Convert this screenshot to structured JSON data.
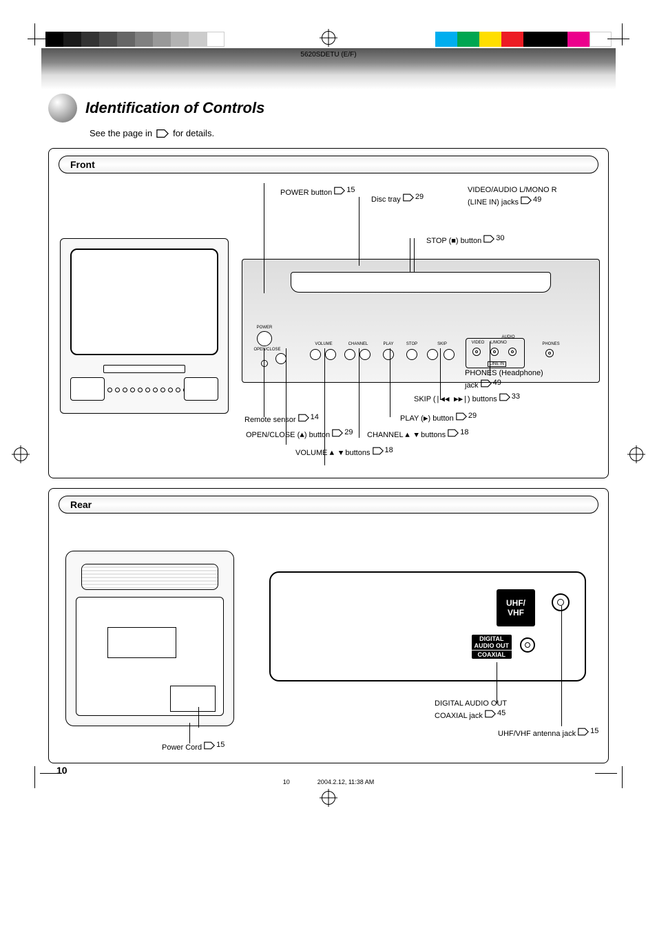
{
  "file_label": "5620SDETU (E/F)",
  "page_number": "10",
  "title": "Identification of Controls",
  "subtitle_prefix": "See the page in ",
  "subtitle_suffix": " for details.",
  "front": {
    "heading": "Front",
    "device_labels": {
      "power": "POWER",
      "open_close": "OPEN/CLOSE",
      "volume": "VOLUME",
      "channel": "CHANNEL",
      "play": "PLAY",
      "stop": "STOP",
      "skip": "SKIP",
      "video": "VIDEO",
      "l_mono": "L/MONO",
      "audio": "AUDIO",
      "line_in": "LINE IN",
      "phones": "PHONES"
    },
    "callouts": {
      "power": {
        "text": "POWER button",
        "page": "15"
      },
      "disc_tray": {
        "text": "Disc tray",
        "page": "29"
      },
      "stop": {
        "text": "STOP (  ) button",
        "page": "30"
      },
      "skip": {
        "text": "SKIP (      ) buttons",
        "page": "33"
      },
      "play": {
        "text": "PLAY (  ) button",
        "page": "29"
      },
      "channel": {
        "text": "CHANNEL       buttons",
        "page": "18"
      },
      "open_close": {
        "text": "OPEN/CLOSE (  ) button",
        "page": "29"
      },
      "remote_sensor": {
        "text": "Remote sensor",
        "page": "14"
      },
      "volume": {
        "text": "VOLUME       buttons",
        "page": "18"
      },
      "phones": {
        "text": "PHONES (Headphone) jack",
        "page": "49"
      },
      "line_in": {
        "line1": "VIDEO/AUDIO L/MONO R",
        "line2": "(LINE IN) jacks",
        "page": "49"
      }
    }
  },
  "rear": {
    "heading": "Rear",
    "labels": {
      "uhf_vhf": "UHF/\nVHF",
      "digital_audio_out": "DIGITAL\nAUDIO OUT",
      "coaxial": "COAXIAL"
    },
    "callouts": {
      "power_cord": {
        "text": "Power Cord",
        "page": "15"
      },
      "coaxial": {
        "line1": "DIGITAL AUDIO OUT",
        "line2": "COAXIAL jack",
        "page": "45"
      },
      "antenna": {
        "line1": "UHF/VHF antenna jack",
        "page": "15"
      }
    }
  },
  "footer": {
    "left": "10",
    "right": "2004.2.12, 11:38 AM"
  }
}
